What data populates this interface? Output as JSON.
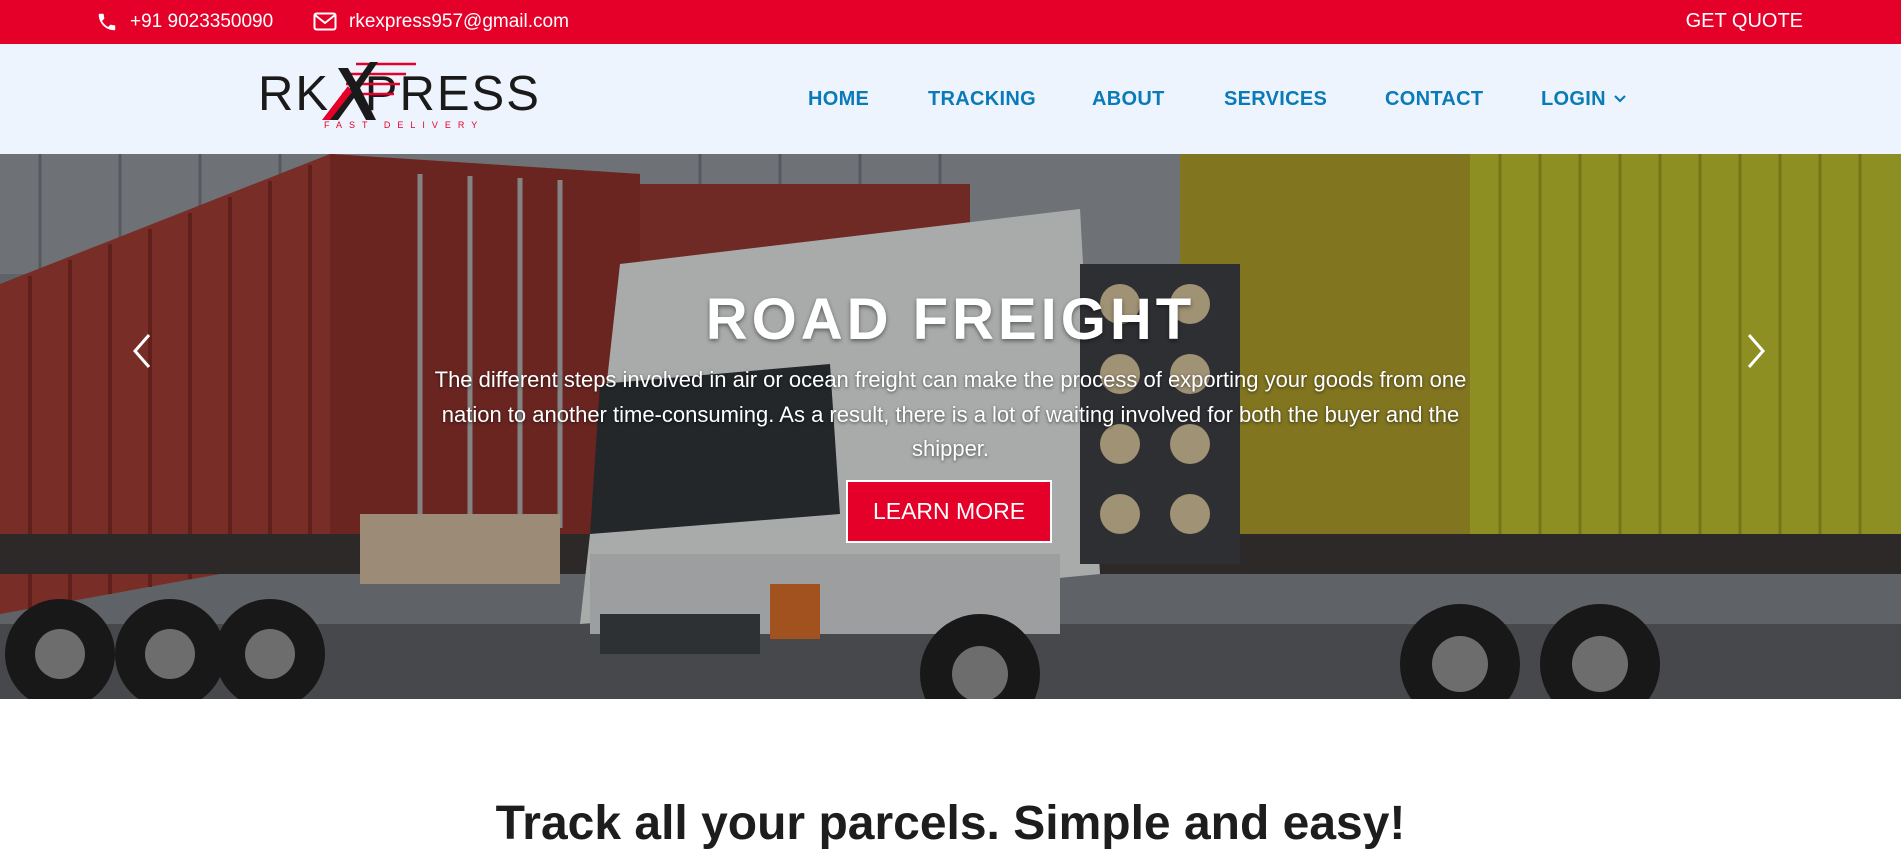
{
  "topbar": {
    "phone": "+91 9023350090",
    "email": "rkexpress957@gmail.com",
    "quote_label": "GET QUOTE",
    "background_color": "#e5002a"
  },
  "logo": {
    "text_left": "RK",
    "text_x": "X",
    "text_right": "PRESS",
    "tagline": "FAST DELIVERY"
  },
  "nav": {
    "items": [
      {
        "label": "HOME"
      },
      {
        "label": "TRACKING"
      },
      {
        "label": "ABOUT"
      },
      {
        "label": "SERVICES"
      },
      {
        "label": "CONTACT"
      },
      {
        "label": "LOGIN"
      }
    ],
    "text_color": "#0a7ab8",
    "background_color": "#eef4fd"
  },
  "hero": {
    "title": "ROAD FREIGHT",
    "description": "The different steps involved in air or ocean freight can make the process of exporting your goods from one nation to another time-consuming. As a result, there is a lot of waiting involved for both the buyer and the shipper.",
    "cta_label": "LEARN MORE",
    "prev_icon": "chevron-left-icon",
    "next_icon": "chevron-right-icon"
  },
  "tracking": {
    "title": "Track all your parcels. Simple and easy!"
  }
}
